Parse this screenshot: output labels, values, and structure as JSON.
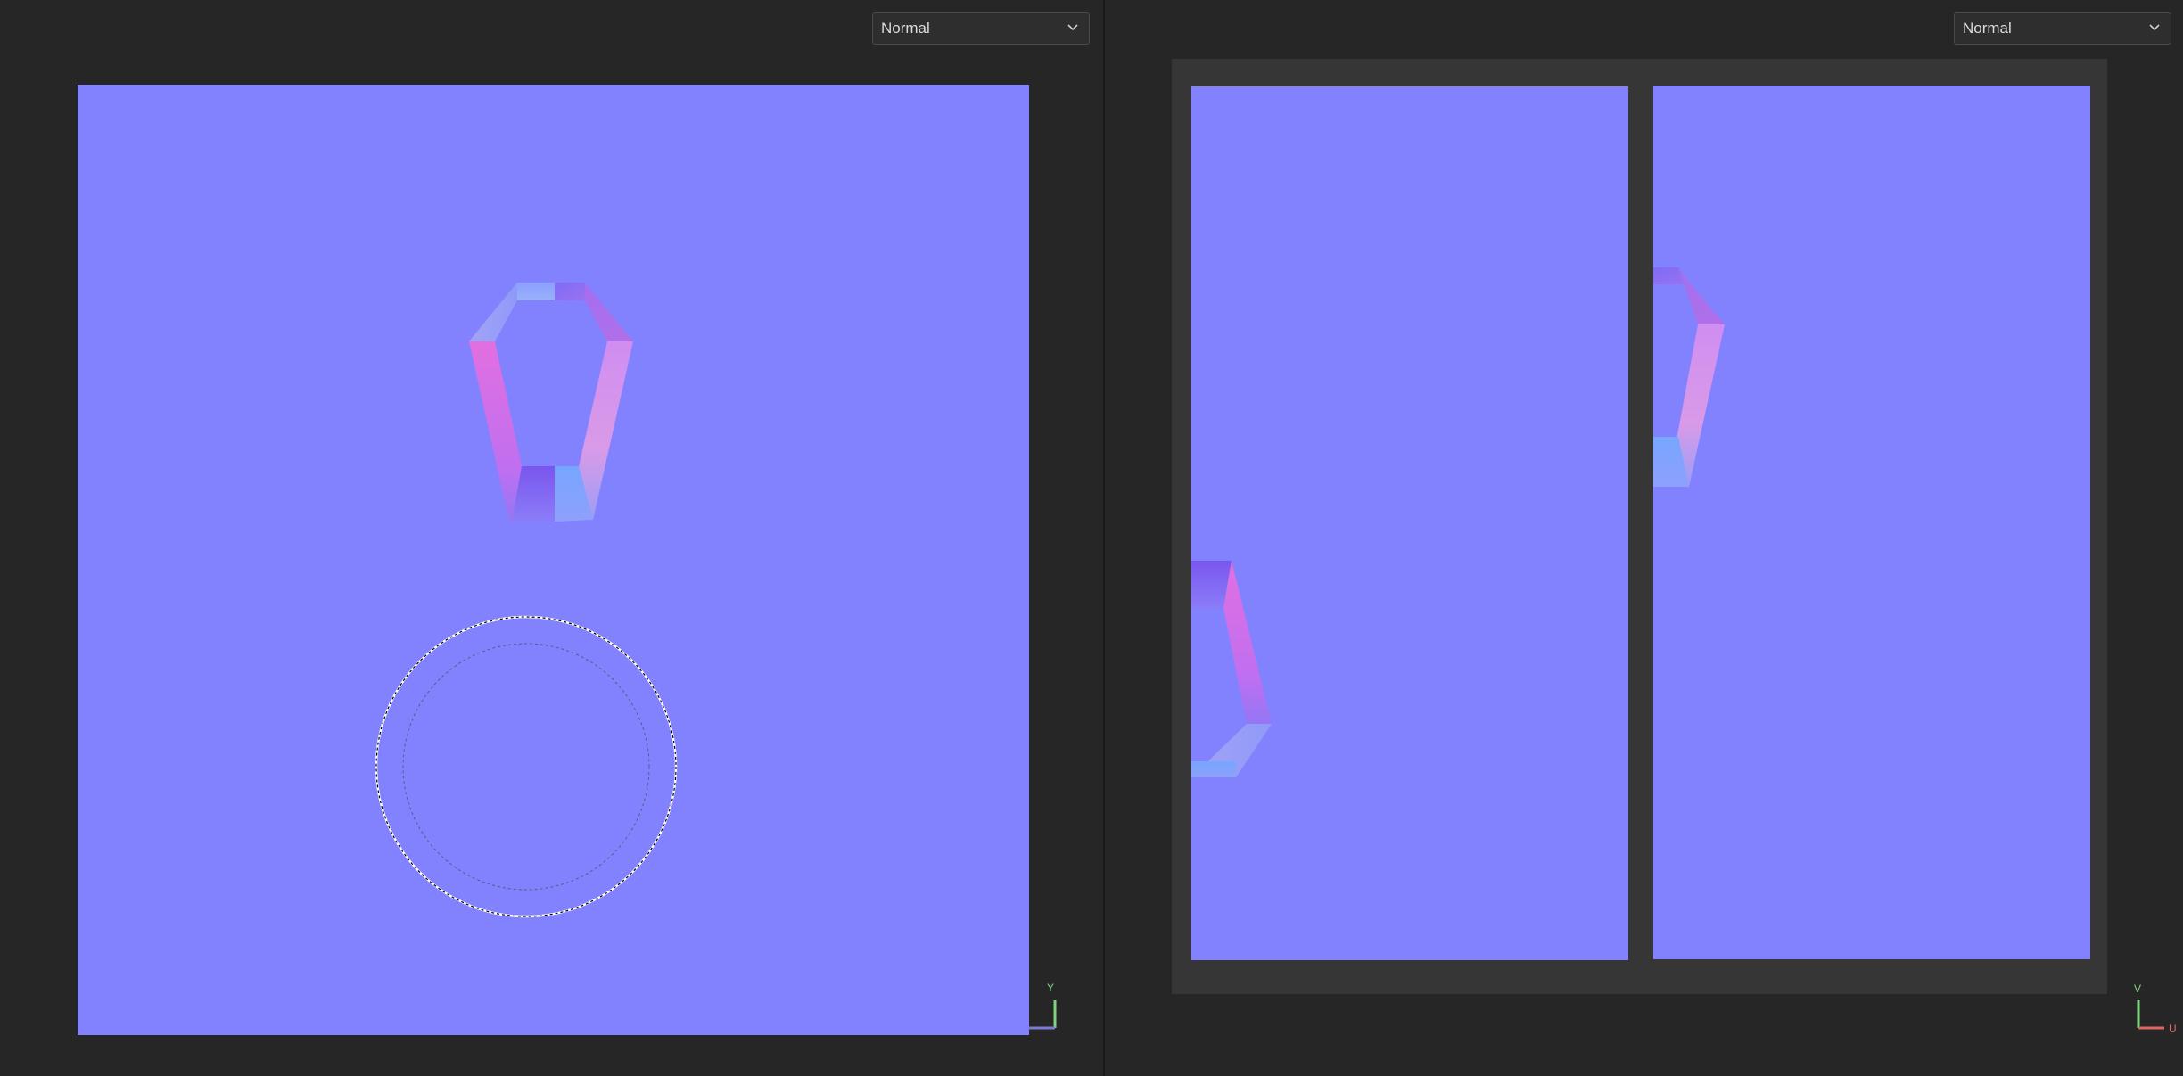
{
  "viewport_3d": {
    "mode_dropdown": {
      "selected": "Normal"
    },
    "axis_gizmo": {
      "y_label": "Y",
      "y_color": "#7fd37f",
      "x_color": "#7b7bd6"
    },
    "fill_color": "#8282ff"
  },
  "viewport_uv": {
    "mode_dropdown": {
      "selected": "Normal"
    },
    "axis_gizmo": {
      "v_label": "V",
      "u_label": "U",
      "v_color": "#7fd37f",
      "u_color": "#e06666"
    },
    "pages": [
      "page-1",
      "page-2"
    ]
  },
  "icons": {
    "dropdown_chevron": "chevron-down-icon",
    "brush_cursor": "brush-cursor-icon"
  }
}
